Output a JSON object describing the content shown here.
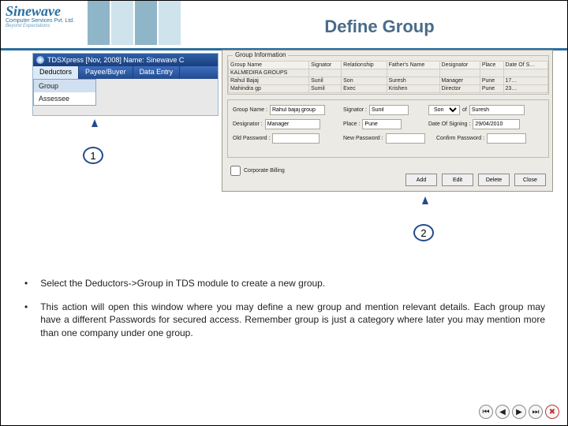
{
  "logo": {
    "name": "Sinewave",
    "sub1": "Computer Services Pvt. Ltd.",
    "sub2": "Beyond Expectations"
  },
  "title": "Define Group",
  "app": {
    "titlebar": "TDSXpress  [Nov, 2008]  Name: Sinewave C",
    "menu": {
      "deductors": "Deductors",
      "payee": "Payee/Buyer",
      "dataentry": "Data Entry"
    },
    "submenu": {
      "group": "Group",
      "assessee": "Assessee"
    }
  },
  "dialog": {
    "group_info_label": "Group Information",
    "cols": {
      "group_name": "Group Name",
      "signator": "Signator",
      "relationship": "Relationship",
      "fathers_name": "Father's Name",
      "Designator": "Designator",
      "place": "Place",
      "date": "Date Of S…"
    },
    "rows": [
      {
        "c0": "KALMEDIRA GROUPS",
        "c1": "",
        "c2": "",
        "c3": "",
        "c4": "",
        "c5": "",
        "c6": ""
      },
      {
        "c0": "Rahul Bajaj",
        "c1": "Sunil",
        "c2": "Son",
        "c3": "Suresh",
        "c4": "Manager",
        "c5": "Pune",
        "c6": "17…"
      },
      {
        "c0": "Mahindra gp",
        "c1": "Sumil",
        "c2": "Exec",
        "c3": "Krishen",
        "c4": "Director",
        "c5": "Pune",
        "c6": "23…"
      }
    ],
    "form": {
      "group_name_label": "Group Name :",
      "group_name_val": "Rahul bajaj group",
      "signator_label": "Signator :",
      "signator_val": "Sunil",
      "rel1": "Son",
      "of_label": "of",
      "rel2": "Suresh",
      "desig_label": "Designator :",
      "desig_val": "Manager",
      "place_label": "Place :",
      "place_val": "Pune",
      "dos_label": "Date Of Signing :",
      "dos_val": "29/04/2010",
      "old_pw": "Old Password :",
      "new_pw": "New Password :",
      "conf_pw": "Confirm Password :",
      "chk_label": "Corporate Billing"
    },
    "buttons": {
      "add": "Add",
      "edit": "Edit",
      "delete": "Delete",
      "close": "Close"
    }
  },
  "callouts": {
    "one": "1",
    "two": "2"
  },
  "bullets": {
    "b1": "Select the Deductors->Group in TDS module to create a new group.",
    "b2": "This action will open this window where you may define a new group and mention relevant details. Each group may have a different Passwords for secured access. Remember group is just a category where later you may mention more than one company under one group."
  },
  "nav": {
    "first": "⏮",
    "prev": "◀",
    "next": "▶",
    "last": "⏭",
    "close": "✖"
  }
}
